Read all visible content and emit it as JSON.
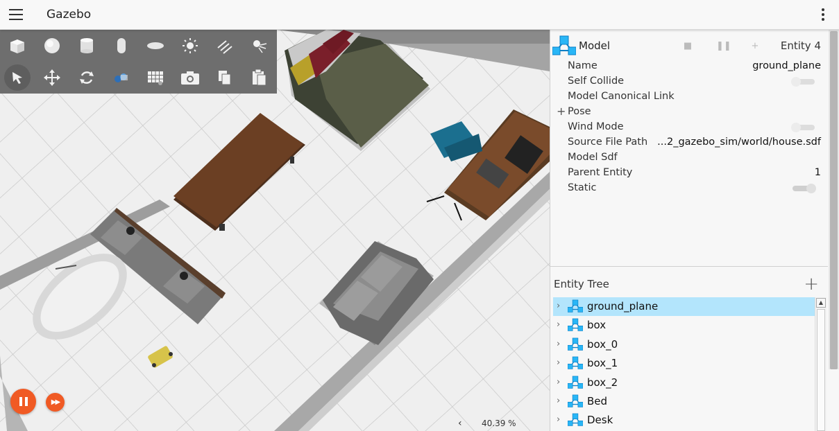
{
  "app": {
    "title": "Gazebo"
  },
  "toolbar": {
    "row1": [
      "box-icon",
      "sphere-icon",
      "cylinder-icon",
      "capsule-icon",
      "ellipsoid-icon",
      "point-light-icon",
      "directional-light-icon",
      "spot-light-icon"
    ],
    "row2": [
      "select-icon",
      "translate-icon",
      "rotate-icon",
      "transform-control-icon",
      "grid-snap-icon",
      "screenshot-icon",
      "copy-icon",
      "paste-icon"
    ]
  },
  "playback": {
    "state": "running"
  },
  "status": {
    "real_time_factor": "40.39 %"
  },
  "component_inspector": {
    "type_label": "Model",
    "entity_id": "Entity 4",
    "properties": [
      {
        "key": "Name",
        "value": "ground_plane"
      },
      {
        "key": "Self Collide",
        "toggle": false
      },
      {
        "key": "Model Canonical Link",
        "value": ""
      },
      {
        "key": "Pose",
        "value": "",
        "expandable": true
      },
      {
        "key": "Wind Mode",
        "toggle": false
      },
      {
        "key": "Source File Path",
        "value": "...2_gazebo_sim/world/house.sdf"
      },
      {
        "key": "Model Sdf",
        "value": ""
      },
      {
        "key": "Parent Entity",
        "value": "1"
      },
      {
        "key": "Static",
        "toggle": true
      }
    ]
  },
  "entity_tree": {
    "title": "Entity Tree",
    "items": [
      {
        "label": "ground_plane",
        "selected": true
      },
      {
        "label": "box",
        "selected": false
      },
      {
        "label": "box_0",
        "selected": false
      },
      {
        "label": "box_1",
        "selected": false
      },
      {
        "label": "box_2",
        "selected": false
      },
      {
        "label": "Bed",
        "selected": false
      },
      {
        "label": "Desk",
        "selected": false
      }
    ]
  },
  "colors": {
    "accent_orange": "#f05a24",
    "selection_blue": "#b3e5fc",
    "model_icon_blue": "#29b6f6"
  }
}
